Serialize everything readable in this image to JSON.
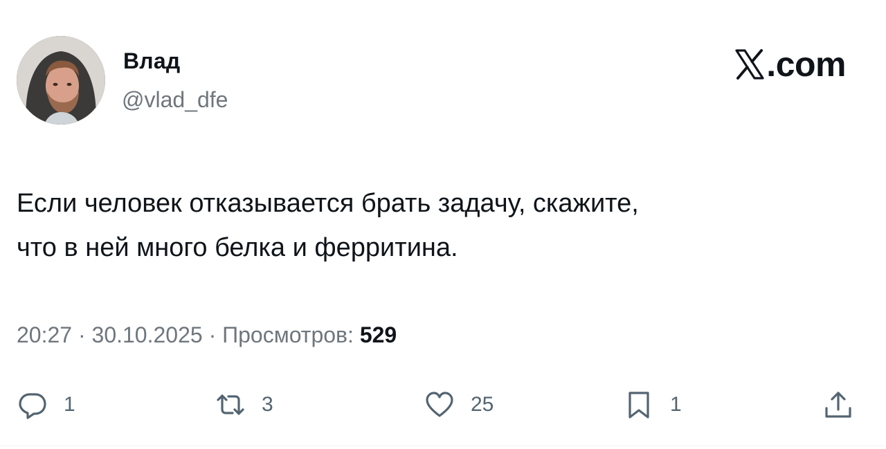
{
  "user": {
    "display_name": "Влад",
    "handle": "@vlad_dfe",
    "avatar_icon": "user-avatar-photo"
  },
  "brand": {
    "label": ".com",
    "icon": "x-logo-icon"
  },
  "tweet": {
    "text_lines": [
      "Если человек отказывается брать задачу, скажите,",
      "что в ней много белка и ферритина."
    ],
    "time": "20:27",
    "date": "30.10.2025",
    "separator": "·",
    "views_label": "Просмотров:",
    "views_count": "529"
  },
  "actions": {
    "reply": {
      "icon": "reply-icon",
      "count": "1"
    },
    "repost": {
      "icon": "repost-icon",
      "count": "3"
    },
    "like": {
      "icon": "heart-icon",
      "count": "25"
    },
    "bookmark": {
      "icon": "bookmark-icon",
      "count": "1"
    },
    "share": {
      "icon": "share-icon"
    }
  },
  "colors": {
    "text_primary": "#0f1419",
    "text_secondary": "#6e767d",
    "icon": "#536471",
    "background": "#ffffff"
  }
}
